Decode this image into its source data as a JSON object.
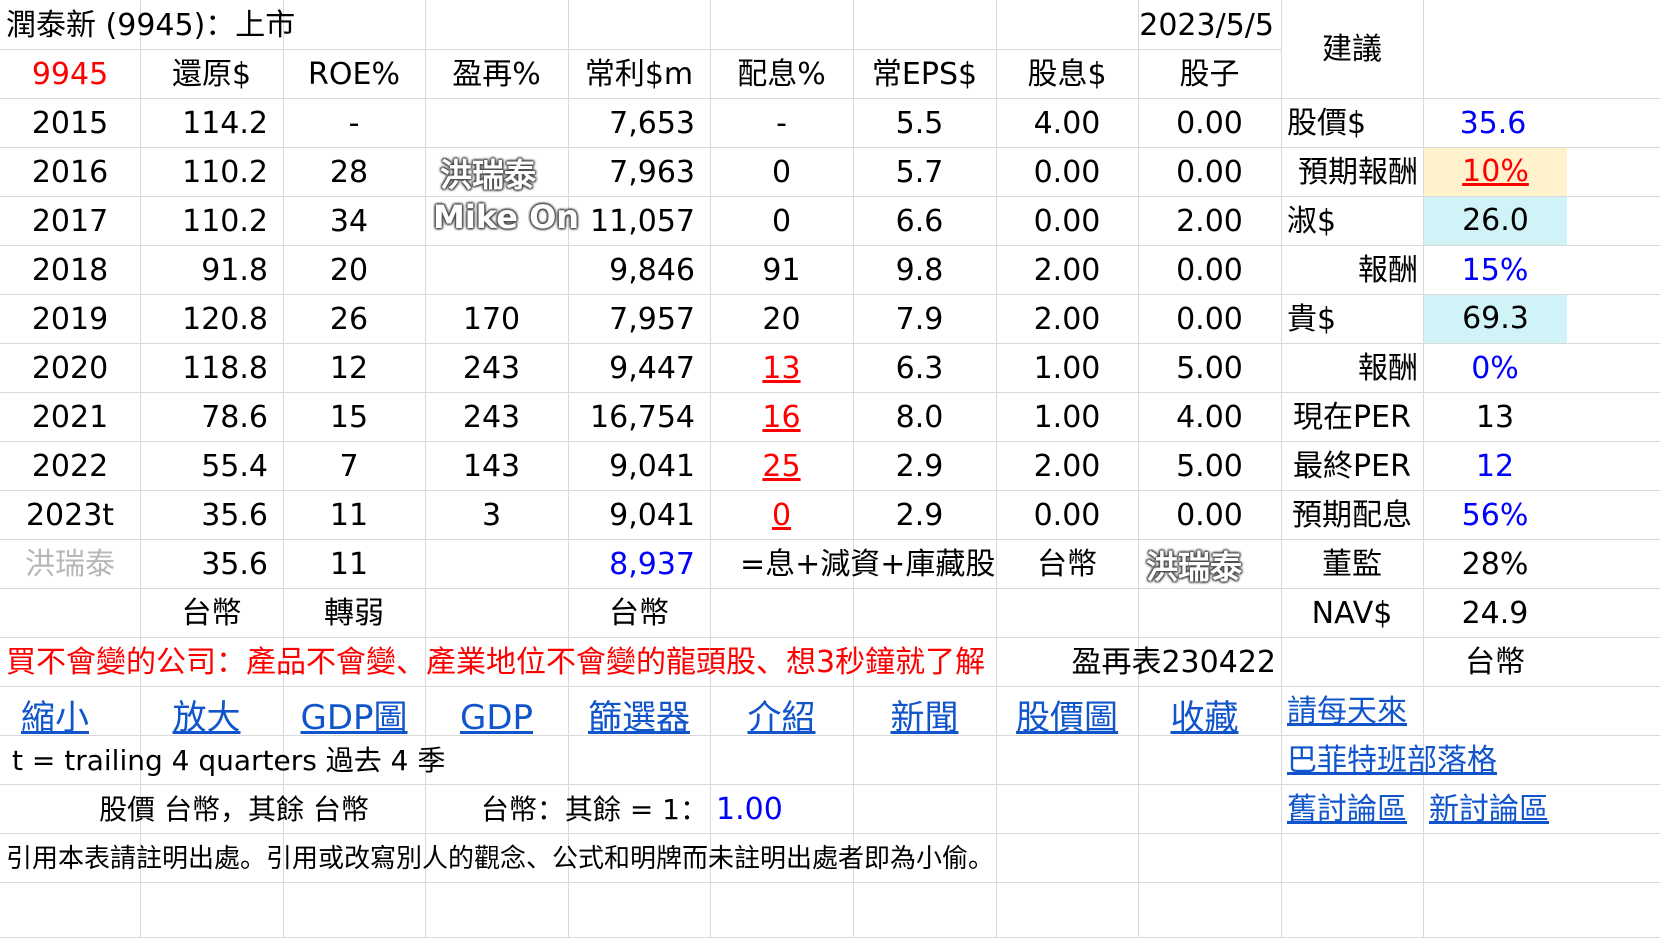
{
  "header": {
    "title": "潤泰新 (9945)：上市",
    "date": "2023/5/5",
    "advice": "建議"
  },
  "columns": [
    "9945",
    "還原$",
    "ROE%",
    "盈再%",
    "常利$m",
    "配息%",
    "常EPS$",
    "股息$",
    "股子"
  ],
  "rows": [
    {
      "year": "2015",
      "restored": "114.2",
      "roe": "-",
      "reinvest": "",
      "profit": "7,653",
      "payout": "-",
      "eps": "5.5",
      "div": "4.00",
      "stock": "0.00"
    },
    {
      "year": "2016",
      "restored": "110.2",
      "roe": "28",
      "reinvest": "",
      "profit": "7,963",
      "payout": "0",
      "eps": "5.7",
      "div": "0.00",
      "stock": "0.00"
    },
    {
      "year": "2017",
      "restored": "110.2",
      "roe": "34",
      "reinvest": "",
      "profit": "11,057",
      "payout": "0",
      "eps": "6.6",
      "div": "0.00",
      "stock": "2.00"
    },
    {
      "year": "2018",
      "restored": "91.8",
      "roe": "20",
      "reinvest": "",
      "profit": "9,846",
      "payout": "91",
      "eps": "9.8",
      "div": "2.00",
      "stock": "0.00"
    },
    {
      "year": "2019",
      "restored": "120.8",
      "roe": "26",
      "reinvest": "170",
      "profit": "7,957",
      "payout": "20",
      "eps": "7.9",
      "div": "2.00",
      "stock": "0.00"
    },
    {
      "year": "2020",
      "restored": "118.8",
      "roe": "12",
      "reinvest": "243",
      "profit": "9,447",
      "payout": "13",
      "eps": "6.3",
      "div": "1.00",
      "stock": "5.00"
    },
    {
      "year": "2021",
      "restored": "78.6",
      "roe": "15",
      "reinvest": "243",
      "profit": "16,754",
      "payout": "16",
      "eps": "8.0",
      "div": "1.00",
      "stock": "4.00"
    },
    {
      "year": "2022",
      "restored": "55.4",
      "roe": "7",
      "reinvest": "143",
      "profit": "9,041",
      "payout": "25",
      "eps": "2.9",
      "div": "2.00",
      "stock": "5.00"
    },
    {
      "year": "2023t",
      "restored": "35.6",
      "roe": "11",
      "reinvest": "3",
      "profit": "9,041",
      "payout": "0",
      "eps": "2.9",
      "div": "0.00",
      "stock": "0.00"
    }
  ],
  "summary": {
    "author": "洪瑞泰",
    "restored": "35.6",
    "roe": "11",
    "profit": "8,937",
    "formula": "=息+減資+庫藏股",
    "currency": "台幣"
  },
  "units": {
    "restored": "台幣",
    "roe_trend": "轉弱",
    "profit": "台幣"
  },
  "side": [
    {
      "label": "股價$",
      "value": "35.6"
    },
    {
      "label": "預期報酬",
      "value": "10%"
    },
    {
      "label": "淑$",
      "value": "26.0"
    },
    {
      "label": "報酬",
      "value": "15%"
    },
    {
      "label": "貴$",
      "value": "69.3"
    },
    {
      "label": "報酬",
      "value": "0%"
    },
    {
      "label": "現在PER",
      "value": "13"
    },
    {
      "label": "最終PER",
      "value": "12"
    },
    {
      "label": "預期配息",
      "value": "56%"
    },
    {
      "label": "董監",
      "value": "28%"
    },
    {
      "label": "NAV$",
      "value": "24.9"
    },
    {
      "label": "",
      "value": "台幣"
    }
  ],
  "slogan": "買不會變的公司：產品不會變、產業地位不會變的龍頭股、想3秒鐘就了解",
  "table_code": "盈再表230422",
  "nav_links": [
    "縮小",
    "放大",
    "GDP圖",
    "GDP",
    "篩選器",
    "介紹",
    "新聞",
    "股價圖",
    "收藏"
  ],
  "right_links": {
    "daily": "請每天來",
    "blog": "巴菲特班部落格",
    "old_forum": "舊討論區",
    "new_forum": "新討論區"
  },
  "note_trailing": "t = trailing 4 quarters 過去 4 季",
  "currency_note": "股價 台幣，其餘 台幣",
  "rate_note": "台幣：其餘 = 1：",
  "rate_value": "1.00",
  "citation": "引用本表請註明出處。引用或改寫別人的觀念、公式和明牌而未註明出處者即為小偷。",
  "watermarks": {
    "name": "洪瑞泰",
    "brand": "Mike On"
  }
}
